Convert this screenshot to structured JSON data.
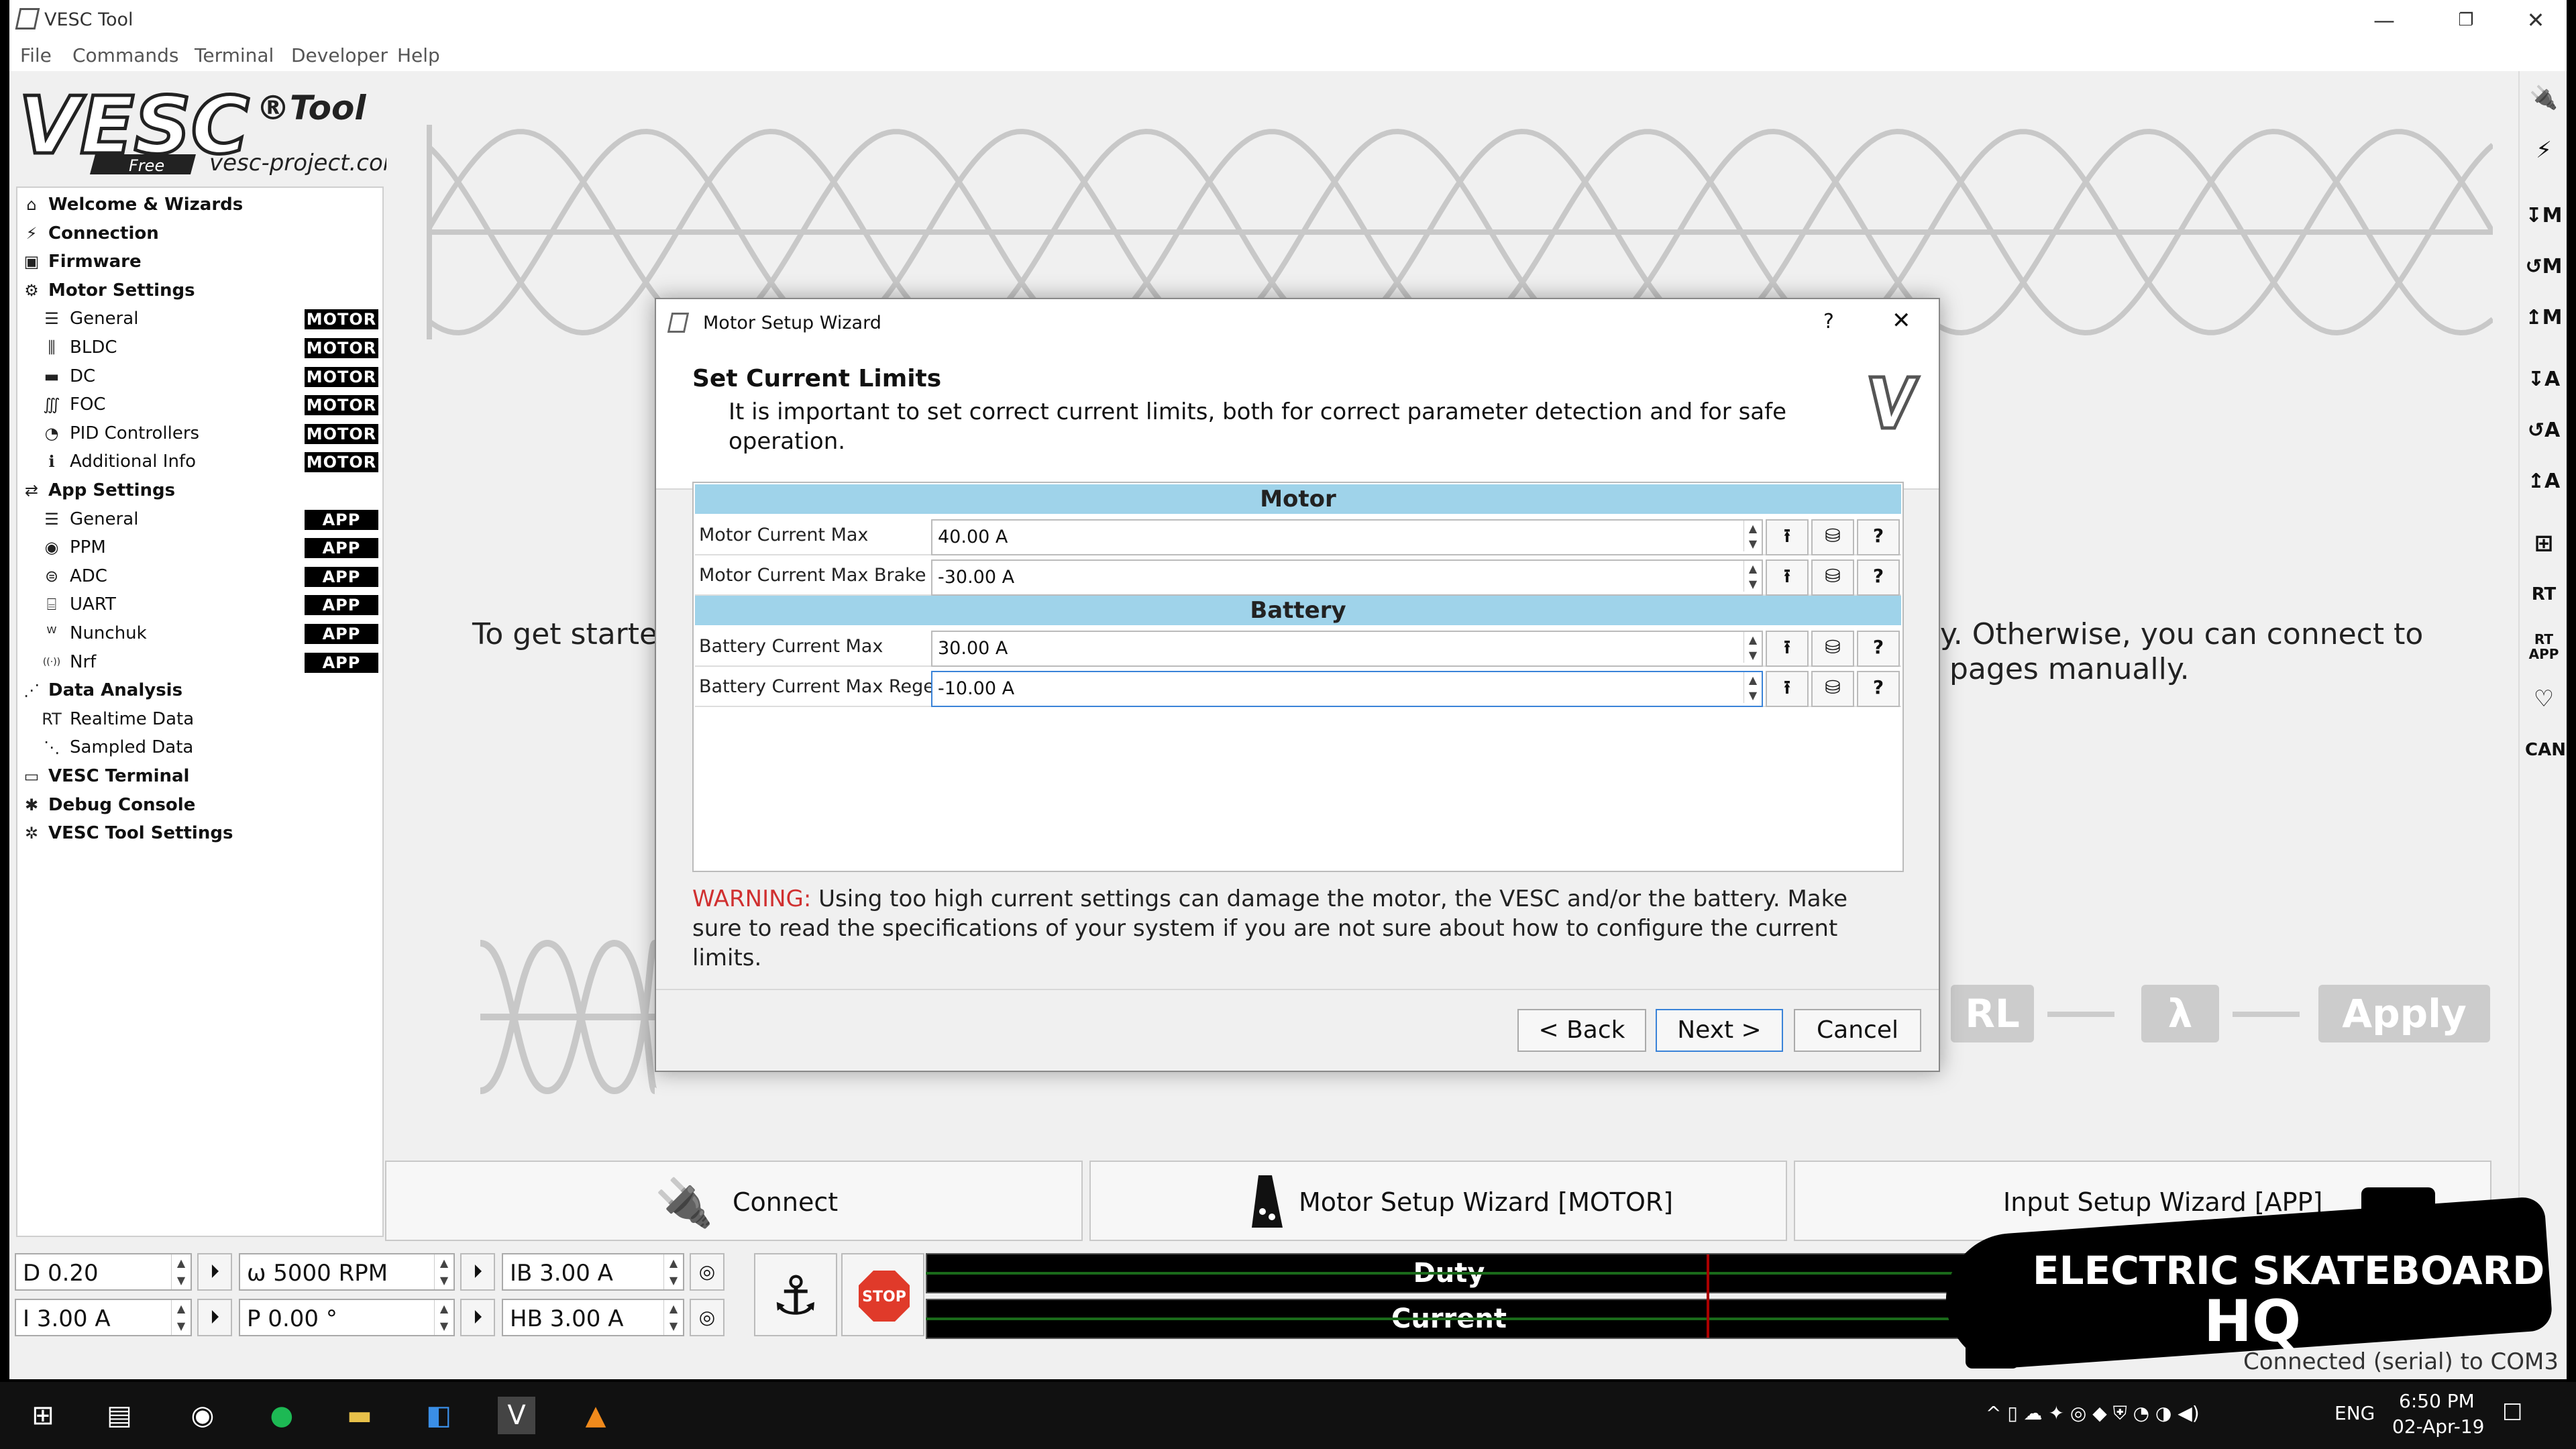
{
  "window": {
    "title": "VESC Tool",
    "menu": [
      "File",
      "Commands",
      "Terminal",
      "Developer",
      "Help"
    ]
  },
  "logo": {
    "brand": "VESC",
    "tool": "®Tool",
    "free": "Free",
    "site": "vesc-project.com"
  },
  "sidebar": {
    "items": [
      {
        "label": "Welcome & Wizards",
        "icon": "home-icon",
        "tag": ""
      },
      {
        "label": "Connection",
        "icon": "plug-icon",
        "tag": ""
      },
      {
        "label": "Firmware",
        "icon": "chip-icon",
        "tag": ""
      },
      {
        "label": "Motor Settings",
        "icon": "motor-icon",
        "tag": ""
      },
      {
        "label": "General",
        "icon": "sliders-icon",
        "tag": "MOTOR"
      },
      {
        "label": "BLDC",
        "icon": "bldc-icon",
        "tag": "MOTOR"
      },
      {
        "label": "DC",
        "icon": "dc-icon",
        "tag": "MOTOR"
      },
      {
        "label": "FOC",
        "icon": "foc-icon",
        "tag": "MOTOR"
      },
      {
        "label": "PID Controllers",
        "icon": "gauge-icon",
        "tag": "MOTOR"
      },
      {
        "label": "Additional Info",
        "icon": "info-icon",
        "tag": "MOTOR"
      },
      {
        "label": "App Settings",
        "icon": "arrows-icon",
        "tag": ""
      },
      {
        "label": "General",
        "icon": "sliders-icon",
        "tag": "APP"
      },
      {
        "label": "PPM",
        "icon": "ppm-icon",
        "tag": "APP"
      },
      {
        "label": "ADC",
        "icon": "adc-icon",
        "tag": "APP"
      },
      {
        "label": "UART",
        "icon": "uart-icon",
        "tag": "APP"
      },
      {
        "label": "Nunchuk",
        "icon": "nunchuk-icon",
        "tag": "APP"
      },
      {
        "label": "Nrf",
        "icon": "nrf-icon",
        "tag": "APP"
      },
      {
        "label": "Data Analysis",
        "icon": "chart-icon",
        "tag": ""
      },
      {
        "label": "Realtime Data",
        "icon": "realtime-icon",
        "tag": ""
      },
      {
        "label": "Sampled Data",
        "icon": "sampled-icon",
        "tag": ""
      },
      {
        "label": "VESC Terminal",
        "icon": "terminal-icon",
        "tag": ""
      },
      {
        "label": "Debug Console",
        "icon": "bug-icon",
        "tag": ""
      },
      {
        "label": "VESC Tool Settings",
        "icon": "gear-icon",
        "tag": ""
      }
    ]
  },
  "right_toolbar": [
    "connect-icon",
    "disconnect-icon",
    "read-motor-icon",
    "read-default-motor-icon",
    "write-motor-icon",
    "read-app-icon",
    "read-default-app-icon",
    "write-app-icon",
    "can-scan-icon",
    "rt-data-icon",
    "rt-app-icon",
    "heart-icon",
    "can-icon"
  ],
  "right_toolbar_labels": [
    "↧M",
    "↺M",
    "↥M",
    "↧A",
    "↺A",
    "↥A",
    "RT",
    "RT APP",
    "♡",
    "CAN"
  ],
  "background": {
    "intro_left": "To get starte",
    "intro_right_1": "y. Otherwise, you can connect to",
    "intro_right_2": "pages manually.",
    "flow": [
      "RL",
      "λ",
      "Apply"
    ]
  },
  "bottom_buttons": {
    "connect": "Connect",
    "motor_wizard": "Motor Setup Wizard [MOTOR]",
    "input_wizard": "Input Setup Wizard [APP]"
  },
  "controls": {
    "duty": "D 0.20",
    "current": "I 3.00 A",
    "rpm": "ω 5000 RPM",
    "position": "P 0.00 °",
    "brake_current": "IB 3.00 A",
    "handbrake": "HB 3.00 A",
    "stop": "STOP",
    "duty_bar": "Duty",
    "current_bar": "Current",
    "status": "Connected (serial) to COM3"
  },
  "dialog": {
    "title": "Motor Setup Wizard",
    "help": "?",
    "heading": "Set Current Limits",
    "subheading": "It is important to set correct current limits, both for correct parameter detection and for safe operation.",
    "groups": [
      {
        "name": "Motor",
        "rows": [
          {
            "label": "Motor Current Max",
            "value": "40.00 A"
          },
          {
            "label": "Motor Current Max Brake",
            "value": "-30.00 A"
          }
        ]
      },
      {
        "name": "Battery",
        "rows": [
          {
            "label": "Battery Current Max",
            "value": "30.00 A"
          },
          {
            "label": "Battery Current Max Regen",
            "value": "-10.00 A"
          }
        ]
      }
    ],
    "warning_label": "WARNING:",
    "warning_text": " Using too high current settings can damage the motor, the VESC and/or the battery. Make sure to read the specifications of your system if you are not sure about how to configure the current limits.",
    "back": "< Back",
    "next": "Next >",
    "cancel": "Cancel"
  },
  "taskbar": {
    "lang": "ENG",
    "time": "6:50 PM",
    "date": "02-Apr-19",
    "notifications": "1"
  },
  "watermark": {
    "line1": "ELECTRIC SKATEBOARD",
    "line2": "HQ"
  },
  "colors": {
    "group_header": "#9fd3ea",
    "warning": "#d03030",
    "tag_bg": "#000000",
    "stop": "#e03a2a"
  }
}
